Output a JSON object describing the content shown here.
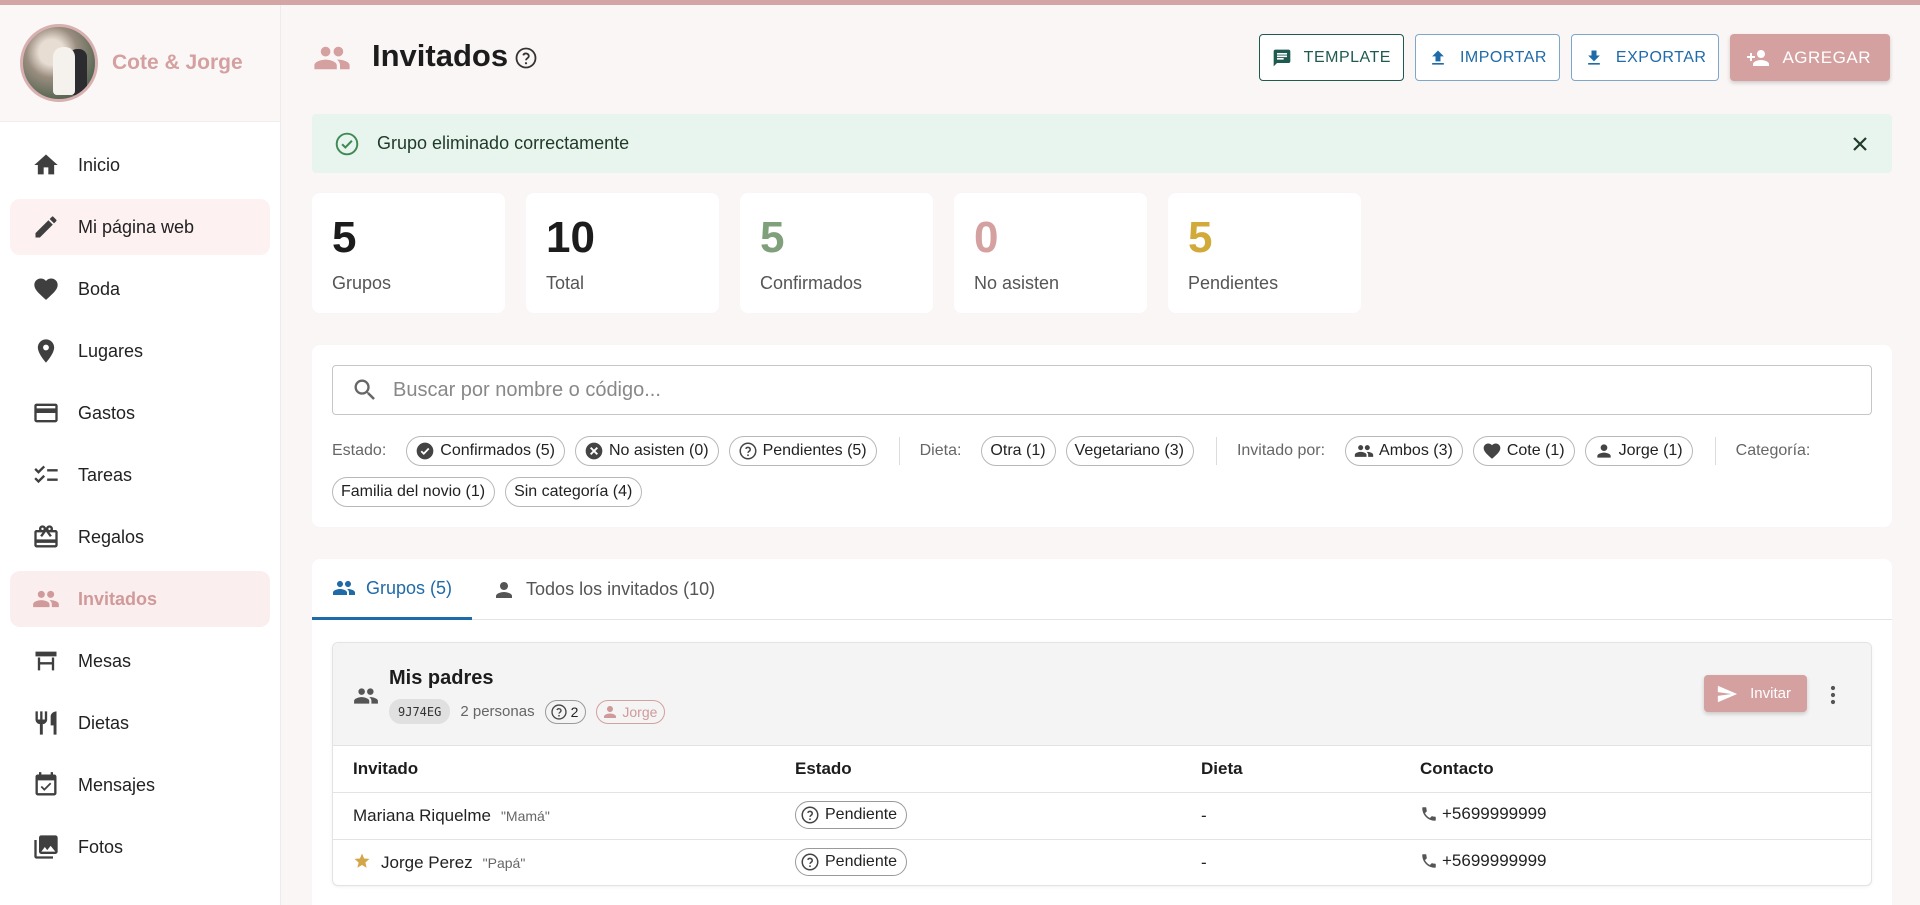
{
  "brand": {
    "name": "Cote & Jorge"
  },
  "sidebar": {
    "items": [
      {
        "label": "Inicio",
        "icon": "home-icon"
      },
      {
        "label": "Mi página web",
        "icon": "pencil-icon"
      },
      {
        "label": "Boda",
        "icon": "heart-icon"
      },
      {
        "label": "Lugares",
        "icon": "location-pin-icon"
      },
      {
        "label": "Gastos",
        "icon": "credit-card-icon"
      },
      {
        "label": "Tareas",
        "icon": "checklist-icon"
      },
      {
        "label": "Regalos",
        "icon": "gift-card-icon"
      },
      {
        "label": "Invitados",
        "icon": "people-icon"
      },
      {
        "label": "Mesas",
        "icon": "table-icon"
      },
      {
        "label": "Dietas",
        "icon": "fork-knife-icon"
      },
      {
        "label": "Mensajes",
        "icon": "calendar-check-icon"
      },
      {
        "label": "Fotos",
        "icon": "photo-library-icon"
      }
    ],
    "active_index": 7
  },
  "header": {
    "title": "Invitados",
    "buttons": {
      "template": "TEMPLATE",
      "importar": "IMPORTAR",
      "exportar": "EXPORTAR",
      "agregar": "AGREGAR"
    }
  },
  "alert": {
    "message": "Grupo eliminado correctamente"
  },
  "stats": [
    {
      "value": "5",
      "label": "Grupos",
      "color": "#1c1c1c"
    },
    {
      "value": "10",
      "label": "Total",
      "color": "#1c1c1c"
    },
    {
      "value": "5",
      "label": "Confirmados",
      "color": "#7fa07a"
    },
    {
      "value": "0",
      "label": "No asisten",
      "color": "#d4a0a0"
    },
    {
      "value": "5",
      "label": "Pendientes",
      "color": "#d1aa3a"
    }
  ],
  "filters": {
    "search_placeholder": "Buscar por nombre o código...",
    "estado_label": "Estado:",
    "estado": [
      "Confirmados (5)",
      "No asisten (0)",
      "Pendientes (5)"
    ],
    "dieta_label": "Dieta:",
    "dieta": [
      "Otra (1)",
      "Vegetariano (3)"
    ],
    "invitado_por_label": "Invitado por:",
    "invitado_por": [
      "Ambos (3)",
      "Cote (1)",
      "Jorge (1)"
    ],
    "categoria_label": "Categoría:",
    "categoria": [
      "Familia del novio (1)",
      "Sin categoría (4)"
    ]
  },
  "tabs": [
    {
      "label": "Grupos (5)"
    },
    {
      "label": "Todos los invitados (10)"
    }
  ],
  "group": {
    "title": "Mis padres",
    "code": "9J74EG",
    "people": "2 personas",
    "pending_count": "2",
    "invited_by": "Jorge",
    "invite_label": "Invitar",
    "columns": [
      "Invitado",
      "Estado",
      "Dieta",
      "Contacto"
    ],
    "rows": [
      {
        "name": "Mariana Riquelme",
        "nickname": "\"Mamá\"",
        "status": "Pendiente",
        "diet": "-",
        "phone": "+5699999999",
        "star": false
      },
      {
        "name": "Jorge Perez",
        "nickname": "\"Papá\"",
        "status": "Pendiente",
        "diet": "-",
        "phone": "+5699999999",
        "star": true
      }
    ]
  },
  "colors": {
    "accent": "#d4a0a0",
    "blue": "#1f6aa8",
    "success_bg": "#e8f5ee"
  }
}
